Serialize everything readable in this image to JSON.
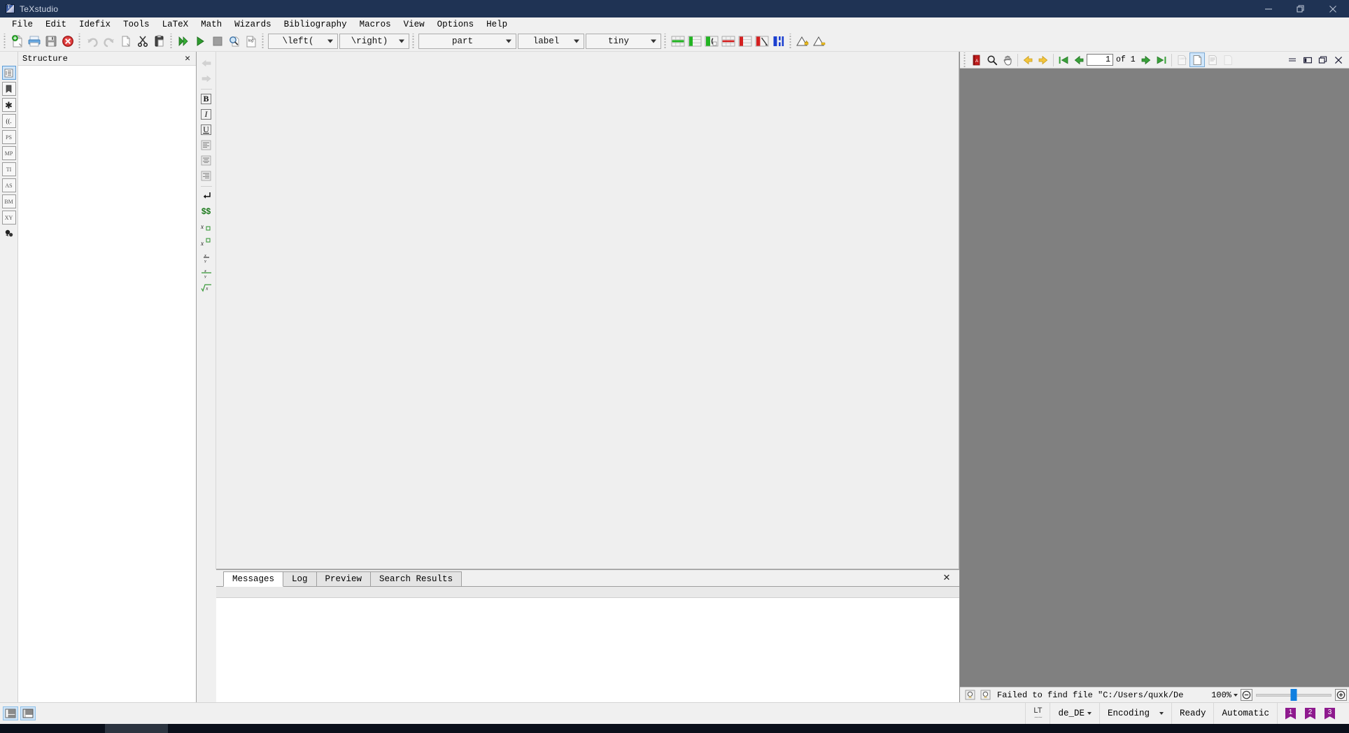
{
  "window": {
    "title": "TeXstudio",
    "minimize_label": "Minimize",
    "maximize_label": "Restore",
    "close_label": "Close"
  },
  "menubar": {
    "items": [
      {
        "label": "File"
      },
      {
        "label": "Edit"
      },
      {
        "label": "Idefix"
      },
      {
        "label": "Tools"
      },
      {
        "label": "LaTeX"
      },
      {
        "label": "Math"
      },
      {
        "label": "Wizards"
      },
      {
        "label": "Bibliography"
      },
      {
        "label": "Macros"
      },
      {
        "label": "View"
      },
      {
        "label": "Options"
      },
      {
        "label": "Help"
      }
    ]
  },
  "toolbar": {
    "file_icons": [
      "new-file-icon",
      "open-file-icon",
      "save-file-icon",
      "close-file-icon"
    ],
    "edit_icons": [
      "undo-icon",
      "redo-icon",
      "copy-icon",
      "cut-icon",
      "paste-icon"
    ],
    "build_icons": [
      "build-and-view-icon",
      "compile-icon",
      "stop-icon",
      "view-pdf-icon",
      "view-log-icon"
    ],
    "table_icons": [
      "add-row-icon",
      "add-column-icon",
      "insert-cell-icon",
      "remove-row-icon",
      "remove-column-icon",
      "remove-cell-icon",
      "align-columns-icon"
    ],
    "warning_icons": [
      "previous-error-icon",
      "next-error-icon"
    ],
    "combos": {
      "left_bracket": "\\left(",
      "right_bracket": "\\right)",
      "section": "part",
      "label": "label",
      "fontsize": "tiny"
    }
  },
  "left_strip": {
    "buttons": [
      {
        "name": "structure-view-button",
        "glyph": "structure-icon",
        "active": true
      },
      {
        "name": "bookmarks-view-button",
        "glyph": "bookmark-icon",
        "active": false
      },
      {
        "name": "symbols-view-button",
        "glyph": "asterisk-icon",
        "active": false
      },
      {
        "name": "brackets-view-button",
        "glyph": "brackets-icon",
        "active": false
      },
      {
        "name": "symbols-ps-button",
        "glyph": "PS",
        "active": false
      },
      {
        "name": "symbols-mp-button",
        "glyph": "MP",
        "active": false
      },
      {
        "name": "symbols-ti-button",
        "glyph": "TI",
        "active": false
      },
      {
        "name": "symbols-as-button",
        "glyph": "AS",
        "active": false
      },
      {
        "name": "symbols-bm-button",
        "glyph": "BM",
        "active": false
      },
      {
        "name": "symbols-xy-button",
        "glyph": "XY",
        "active": false
      },
      {
        "name": "symbols-extra-button",
        "glyph": "puzzle-icon",
        "active": false
      }
    ]
  },
  "structure_panel": {
    "title": "Structure",
    "close_label": "✕",
    "content": ""
  },
  "format_strip": {
    "buttons": [
      {
        "name": "previous-change-button",
        "glyph": "left-arrow-icon"
      },
      {
        "name": "next-change-button",
        "glyph": "right-arrow-icon"
      },
      {
        "name": "bold-button",
        "glyph": "B"
      },
      {
        "name": "italic-button",
        "glyph": "I"
      },
      {
        "name": "underline-button",
        "glyph": "U"
      },
      {
        "name": "align-left-button",
        "glyph": "align-left-icon"
      },
      {
        "name": "align-center-button",
        "glyph": "align-center-icon"
      },
      {
        "name": "align-right-button",
        "glyph": "align-right-icon"
      },
      {
        "name": "newline-button",
        "glyph": "newline-icon"
      },
      {
        "name": "inline-math-button",
        "glyph": "$$"
      },
      {
        "name": "subscript-button",
        "glyph": "subscript-icon"
      },
      {
        "name": "superscript-button",
        "glyph": "superscript-icon"
      },
      {
        "name": "fraction-button",
        "glyph": "fraction-icon"
      },
      {
        "name": "dfraction-button",
        "glyph": "dfraction-icon"
      },
      {
        "name": "sqrt-button",
        "glyph": "sqrt-icon"
      }
    ]
  },
  "output_panel": {
    "tabs": [
      {
        "label": "Messages",
        "active": true
      },
      {
        "label": "Log",
        "active": false
      },
      {
        "label": "Preview",
        "active": false
      },
      {
        "label": "Search Results",
        "active": false
      }
    ],
    "close_label": "✕",
    "content": ""
  },
  "pdf_viewer": {
    "toolbar": {
      "open_pdf_label": "pdf-icon",
      "magnify_label": "magnify-icon",
      "hand_label": "hand-tool-icon",
      "back_label": "back-arrow-icon",
      "forward_label": "forward-arrow-icon",
      "first_page_label": "first-page-icon",
      "prev_page_label": "previous-page-icon",
      "next_page_label": "next-page-icon",
      "last_page_label": "last-page-icon",
      "fit_width_label": "fit-width-icon",
      "fit_page_label": "fit-page-icon",
      "fit_text_width_label": "fit-text-width-icon",
      "single_page_label": "single-page-icon"
    },
    "page_current": "1",
    "page_of_text": "of  1",
    "dock_buttons": [
      "minimize-pane-icon",
      "dock-left-icon",
      "float-pane-icon",
      "close-pane-icon"
    ],
    "status": {
      "magnifier_icons": [
        "magnifier-left-icon",
        "magnifier-right-icon"
      ],
      "message": "Failed to find file \"C:/Users/quxk/De",
      "zoom_value": "100%",
      "zoom_out_label": "⊖",
      "zoom_in_label": "⊕"
    }
  },
  "statusbar": {
    "panel_buttons": [
      "toggle-left-panel-icon",
      "toggle-bottom-panel-icon"
    ],
    "language_tool": "LT",
    "language": "de_DE",
    "encoding": "Encoding",
    "state": "Ready",
    "mode": "Automatic",
    "bookmarks": [
      "1",
      "2",
      "3"
    ]
  },
  "colors": {
    "titlebar_bg": "#1f3354",
    "accent_blue": "#0f7fe0",
    "green": "#2e9b2e",
    "red": "#cc2222",
    "pdf_bg": "#808080",
    "bookmark_purple": "#8e1a8e"
  }
}
